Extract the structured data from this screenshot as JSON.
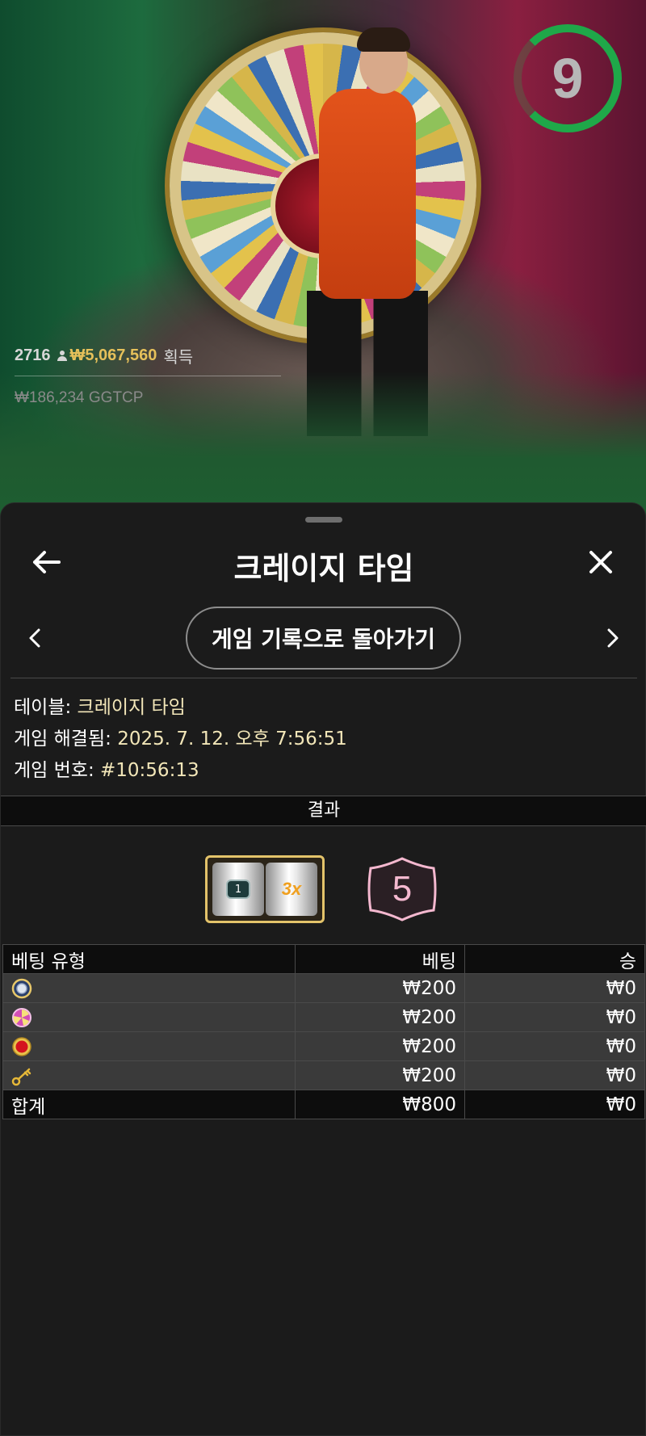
{
  "video": {
    "timer": "9",
    "players_count": "2716",
    "total_win": "₩5,067,560",
    "total_win_label": "획득",
    "balance_line": "₩186,234 GGTCP"
  },
  "header": {
    "title": "크레이지 타임",
    "back_icon": "arrow-left-icon",
    "close_icon": "close-icon"
  },
  "nav": {
    "history_button": "게임 기록으로 돌아가기"
  },
  "info": {
    "table_label": "테이블:",
    "table_value": "크레이지 타임",
    "resolved_label": "게임 해결됨:",
    "resolved_value": "2025. 7. 12. 오후 7:56:51",
    "round_label": "게임 번호:",
    "round_value": "#10:56:13"
  },
  "result": {
    "section_title": "결과",
    "slot_left": "1",
    "slot_right": "3x",
    "number": "5"
  },
  "bets": {
    "headers": [
      "베팅 유형",
      "베팅",
      "승"
    ],
    "rows": [
      {
        "icon": "coin-flip-icon",
        "bet": "₩200",
        "win": "₩0"
      },
      {
        "icon": "pachinko-icon",
        "bet": "₩200",
        "win": "₩0"
      },
      {
        "icon": "cash-hunt-icon",
        "bet": "₩200",
        "win": "₩0"
      },
      {
        "icon": "crazy-time-key-icon",
        "bet": "₩200",
        "win": "₩0"
      }
    ],
    "total": {
      "label": "합계",
      "bet": "₩800",
      "win": "₩0"
    }
  },
  "colors": {
    "accent_gold": "#e6c05a",
    "timer_green": "#1fa849",
    "panel_bg": "#1b1b1b",
    "info_value": "#f2e6b8"
  }
}
